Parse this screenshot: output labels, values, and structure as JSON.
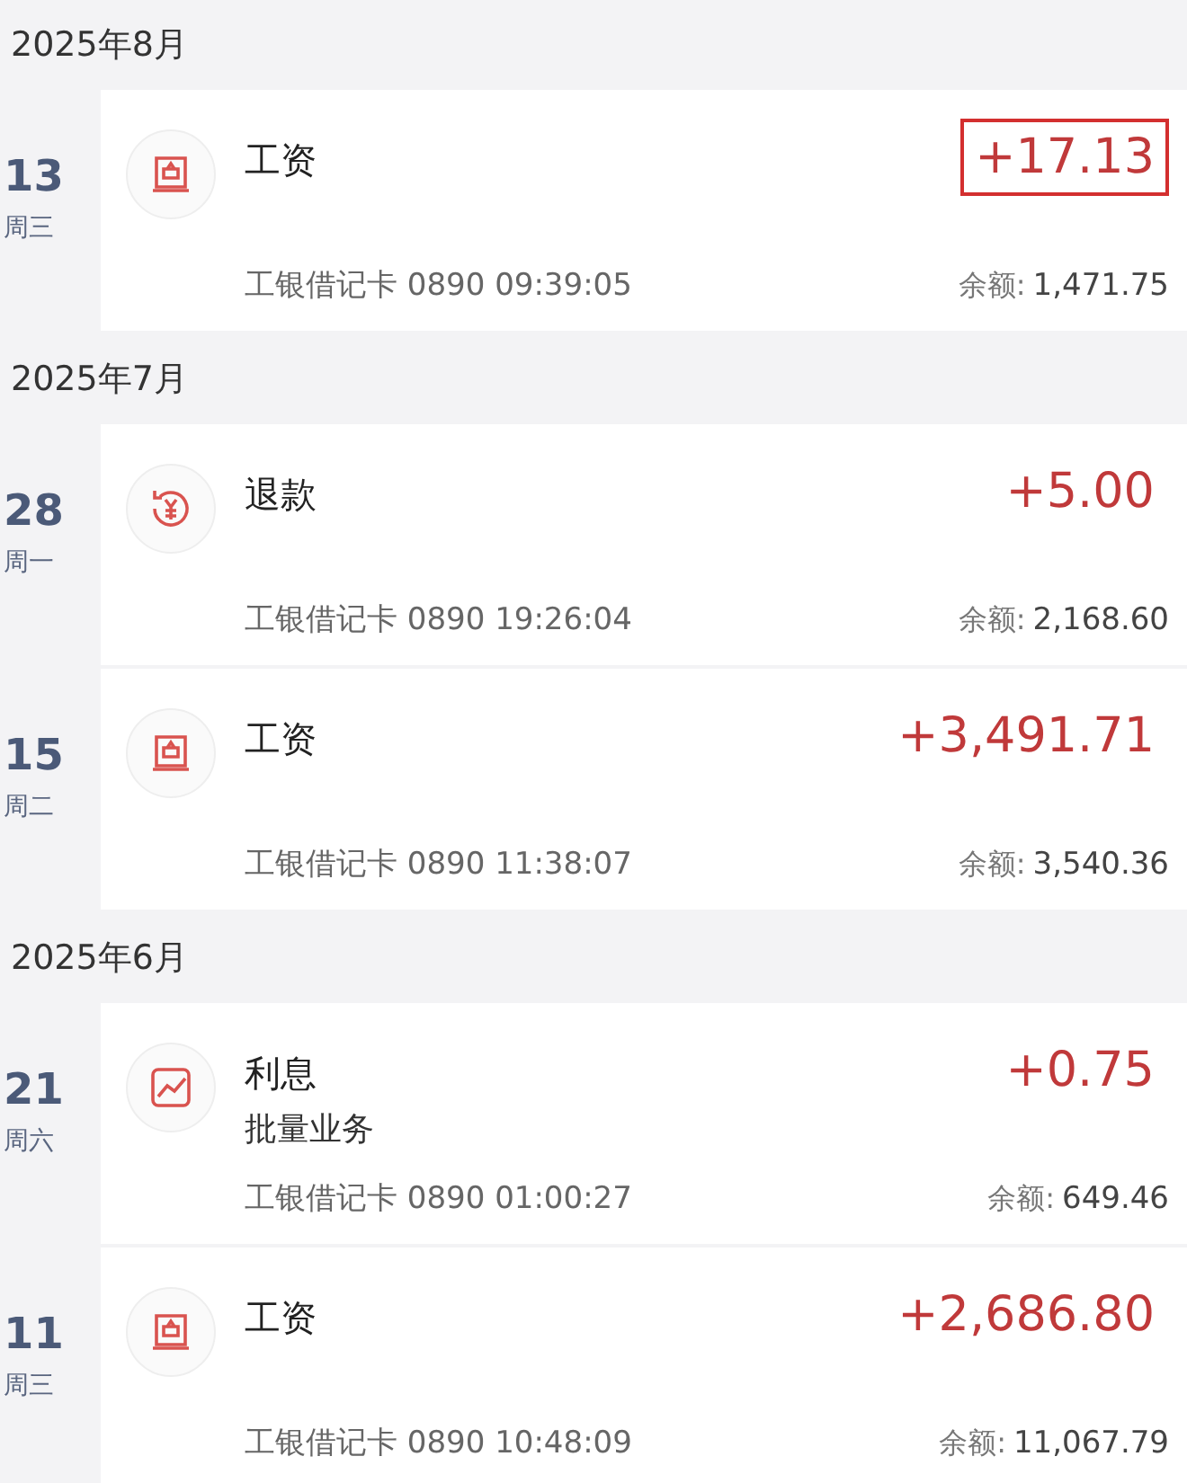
{
  "months": [
    {
      "title": "2025年8月",
      "transactions": [
        {
          "day": "13",
          "weekday": "周三",
          "kind": "salary",
          "title": "工资",
          "amount": "+17.13",
          "highlighted": true,
          "account": "工银借记卡 0890 09:39:05",
          "balance_label": "余额:",
          "balance": "1,471.75"
        }
      ]
    },
    {
      "title": "2025年7月",
      "transactions": [
        {
          "day": "28",
          "weekday": "周一",
          "kind": "refund",
          "title": "退款",
          "amount": "+5.00",
          "highlighted": false,
          "account": "工银借记卡 0890 19:26:04",
          "balance_label": "余额:",
          "balance": "2,168.60"
        },
        {
          "day": "15",
          "weekday": "周二",
          "kind": "salary",
          "title": "工资",
          "amount": "+3,491.71",
          "highlighted": false,
          "account": "工银借记卡 0890 11:38:07",
          "balance_label": "余额:",
          "balance": "3,540.36"
        }
      ]
    },
    {
      "title": "2025年6月",
      "transactions": [
        {
          "day": "21",
          "weekday": "周六",
          "kind": "interest",
          "title": "利息",
          "subtitle": "批量业务",
          "amount": "+0.75",
          "highlighted": false,
          "account": "工银借记卡 0890 01:00:27",
          "balance_label": "余额:",
          "balance": "649.46"
        },
        {
          "day": "11",
          "weekday": "周三",
          "kind": "salary",
          "title": "工资",
          "amount": "+2,686.80",
          "highlighted": false,
          "account": "工银借记卡 0890 10:48:09",
          "balance_label": "余额:",
          "balance": "11,067.79"
        }
      ]
    }
  ]
}
